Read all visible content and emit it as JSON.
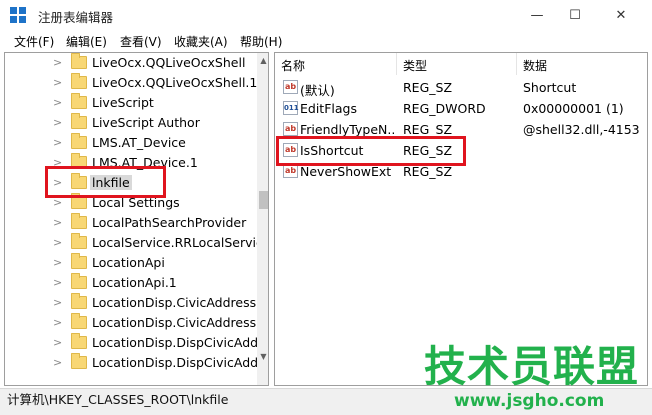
{
  "window": {
    "title": "注册表编辑器",
    "minimize": "—",
    "maximize": "☐",
    "close": "✕"
  },
  "menu": [
    "文件(F)",
    "编辑(E)",
    "查看(V)",
    "收藏夹(A)",
    "帮助(H)"
  ],
  "tree": {
    "items": [
      {
        "label": "LiveOcx.QQLiveOcxShell"
      },
      {
        "label": "LiveOcx.QQLiveOcxShell.1"
      },
      {
        "label": "LiveScript"
      },
      {
        "label": "LiveScript Author"
      },
      {
        "label": "LMS.AT_Device"
      },
      {
        "label": "LMS.AT_Device.1"
      },
      {
        "label": "lnkfile",
        "selected": true
      },
      {
        "label": "Local Settings"
      },
      {
        "label": "LocalPathSearchProvider"
      },
      {
        "label": "LocalService.RRLocalService"
      },
      {
        "label": "LocationApi"
      },
      {
        "label": "LocationApi.1"
      },
      {
        "label": "LocationDisp.CivicAddressR"
      },
      {
        "label": "LocationDisp.CivicAddressR"
      },
      {
        "label": "LocationDisp.DispCivicAddre"
      },
      {
        "label": "LocationDisp.DispCivicAddre"
      }
    ]
  },
  "values": {
    "columns": [
      "名称",
      "类型",
      "数据"
    ],
    "rows": [
      {
        "icon": "string-value-icon",
        "name": "(默认)",
        "type": "REG_SZ",
        "data": "Shortcut"
      },
      {
        "icon": "binary-value-icon",
        "name": "EditFlags",
        "type": "REG_DWORD",
        "data": "0x00000001 (1)"
      },
      {
        "icon": "string-value-icon",
        "name": "FriendlyTypeN...",
        "type": "REG_SZ",
        "data": "@shell32.dll,-4153"
      },
      {
        "icon": "string-value-icon",
        "name": "IsShortcut",
        "type": "REG_SZ",
        "data": ""
      },
      {
        "icon": "string-value-icon",
        "name": "NeverShowExt",
        "type": "REG_SZ",
        "data": ""
      }
    ]
  },
  "status": {
    "path": "计算机\\HKEY_CLASSES_ROOT\\lnkfile"
  },
  "watermark": {
    "brand": "技术员联盟",
    "url": "www.jsgho.com"
  },
  "colors": {
    "highlight": "#e0141e",
    "watermark": "#22b14c",
    "folder": "#f8d775"
  }
}
